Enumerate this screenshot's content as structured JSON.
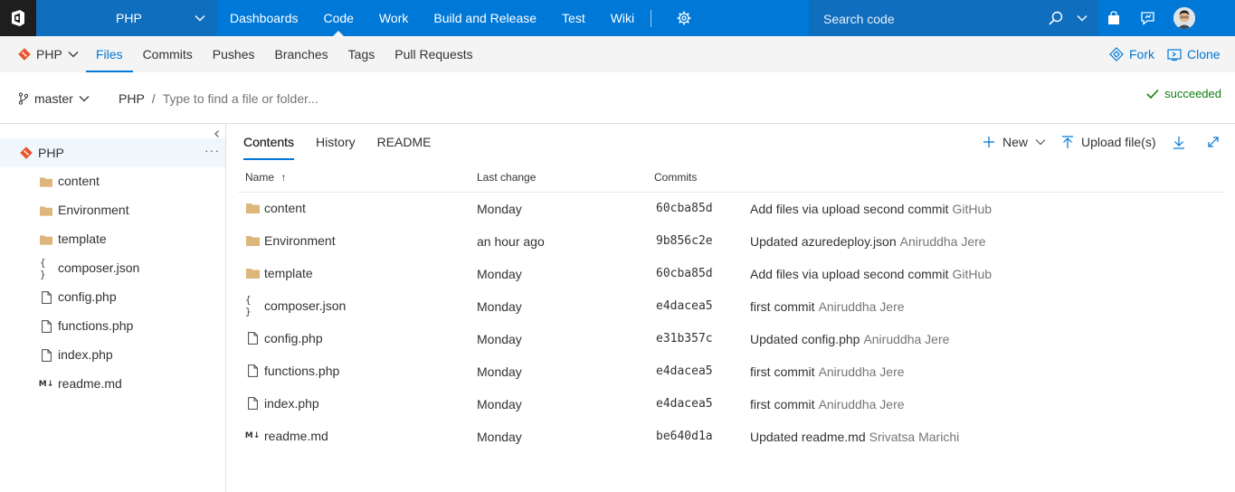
{
  "nav": {
    "project": "PHP",
    "hubs": [
      "Dashboards",
      "Code",
      "Work",
      "Build and Release",
      "Test",
      "Wiki"
    ],
    "active_hub": "Code",
    "search_placeholder": "Search code"
  },
  "subnav": {
    "repo": "PHP",
    "tabs": [
      "Files",
      "Commits",
      "Pushes",
      "Branches",
      "Tags",
      "Pull Requests"
    ],
    "active_tab": "Files",
    "fork_label": "Fork",
    "clone_label": "Clone"
  },
  "pathbar": {
    "branch": "master",
    "root": "PHP",
    "separator": "/",
    "filter_placeholder": "Type to find a file or folder...",
    "build_status": "succeeded"
  },
  "tree": {
    "root": "PHP",
    "more": "···",
    "items": [
      {
        "name": "content",
        "type": "folder"
      },
      {
        "name": "Environment",
        "type": "folder"
      },
      {
        "name": "template",
        "type": "folder"
      },
      {
        "name": "composer.json",
        "type": "json"
      },
      {
        "name": "config.php",
        "type": "file"
      },
      {
        "name": "functions.php",
        "type": "file"
      },
      {
        "name": "index.php",
        "type": "file"
      },
      {
        "name": "readme.md",
        "type": "markdown"
      }
    ]
  },
  "content": {
    "tabs": [
      "Contents",
      "History",
      "README"
    ],
    "active_tab": "Contents",
    "new_label": "New",
    "upload_label": "Upload file(s)",
    "columns": {
      "name": "Name",
      "sort_arrow": "↑",
      "last_change": "Last change",
      "commits": "Commits"
    },
    "rows": [
      {
        "name": "content",
        "type": "folder",
        "last_change": "Monday",
        "commit": "60cba85d",
        "message": "Add files via upload second commit",
        "author": "GitHub"
      },
      {
        "name": "Environment",
        "type": "folder",
        "last_change": "an hour ago",
        "commit": "9b856c2e",
        "message": "Updated azuredeploy.json",
        "author": "Aniruddha Jere"
      },
      {
        "name": "template",
        "type": "folder",
        "last_change": "Monday",
        "commit": "60cba85d",
        "message": "Add files via upload second commit",
        "author": "GitHub"
      },
      {
        "name": "composer.json",
        "type": "json",
        "last_change": "Monday",
        "commit": "e4dacea5",
        "message": "first commit",
        "author": "Aniruddha Jere"
      },
      {
        "name": "config.php",
        "type": "file",
        "last_change": "Monday",
        "commit": "e31b357c",
        "message": "Updated config.php",
        "author": "Aniruddha Jere"
      },
      {
        "name": "functions.php",
        "type": "file",
        "last_change": "Monday",
        "commit": "e4dacea5",
        "message": "first commit",
        "author": "Aniruddha Jere"
      },
      {
        "name": "index.php",
        "type": "file",
        "last_change": "Monday",
        "commit": "e4dacea5",
        "message": "first commit",
        "author": "Aniruddha Jere"
      },
      {
        "name": "readme.md",
        "type": "markdown",
        "last_change": "Monday",
        "commit": "be640d1a",
        "message": "Updated readme.md",
        "author": "Srivatsa Marichi"
      }
    ]
  },
  "colors": {
    "accent": "#0078d7",
    "topbar": "#0078d7",
    "git": "#e9532b",
    "folder": "#dcb67a",
    "success": "#107c10"
  }
}
